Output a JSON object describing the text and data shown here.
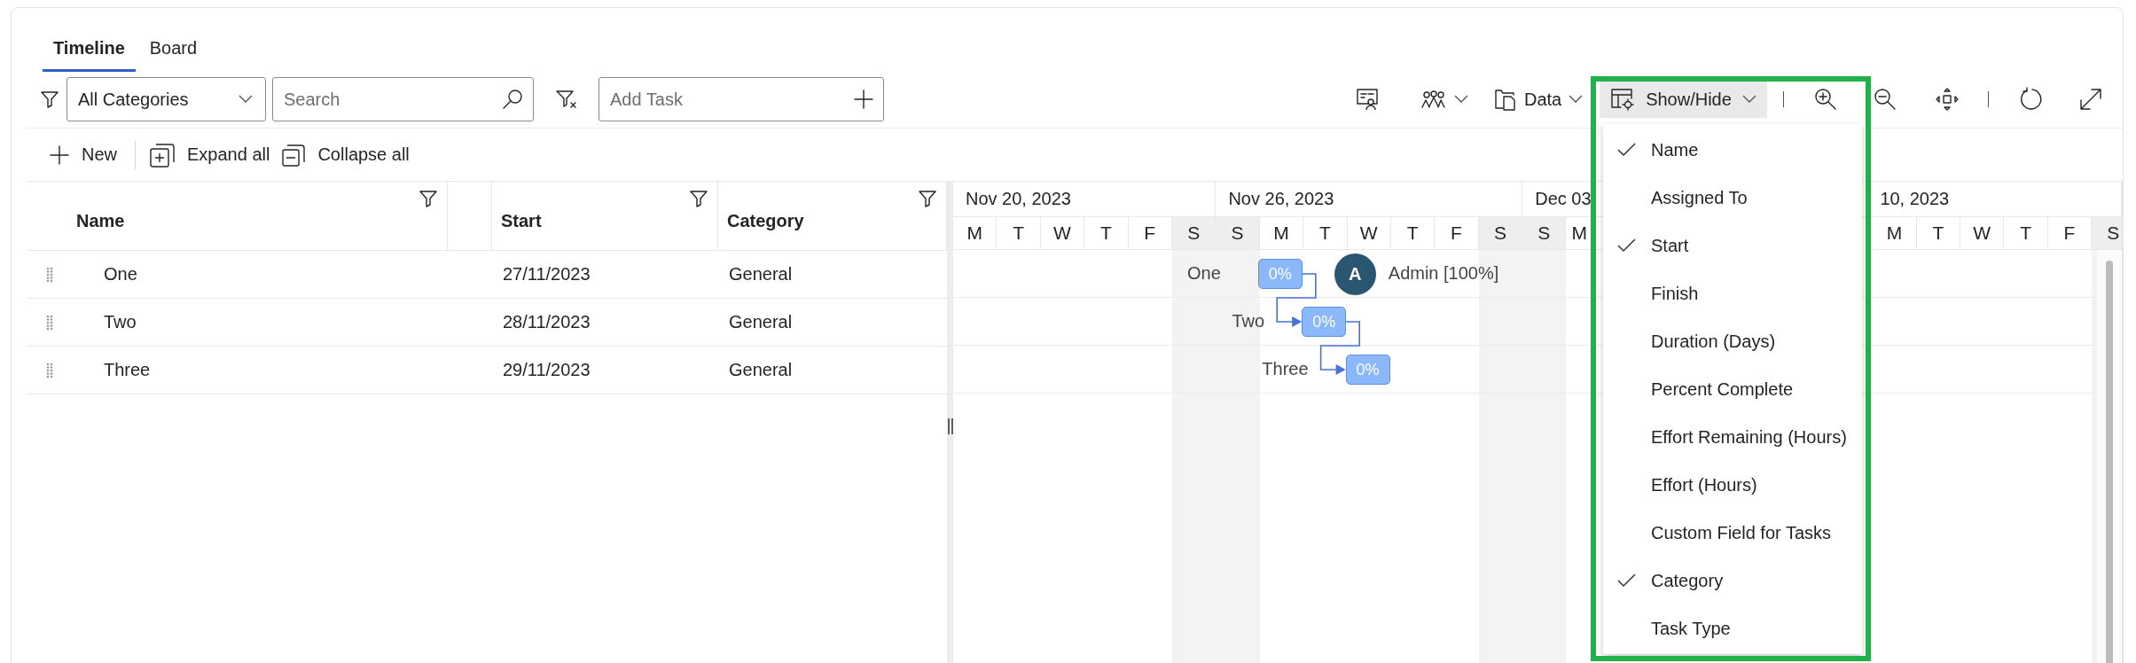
{
  "tabs": [
    {
      "label": "Timeline",
      "selected": true
    },
    {
      "label": "Board",
      "selected": false
    }
  ],
  "filters": {
    "category": "All Categories",
    "search": {
      "placeholder": "Search"
    },
    "add_task": {
      "placeholder": "Add Task"
    }
  },
  "toolbar": {
    "data": "Data",
    "show_hide": {
      "label": "Show/Hide",
      "expanded": true
    }
  },
  "commands": [
    {
      "kind": "new",
      "label": "New"
    },
    {
      "kind": "expand",
      "label": "Expand all"
    },
    {
      "kind": "collapse",
      "label": "Collapse all"
    }
  ],
  "grid": {
    "columns": [
      {
        "label": "Name",
        "filterable": true
      },
      {
        "label": "Start",
        "filterable": true
      },
      {
        "label": "Category",
        "filterable": true
      }
    ],
    "rows": [
      {
        "name": "One",
        "start": "27/11/2023",
        "category": "General"
      },
      {
        "name": "Two",
        "start": "28/11/2023",
        "category": "General"
      },
      {
        "name": "Three",
        "start": "29/11/2023",
        "category": "General"
      }
    ]
  },
  "timeline": {
    "weeks": [
      {
        "label": "Nov 20, 2023",
        "days": [
          {
            "label": "M",
            "weekend": false
          },
          {
            "label": "T",
            "weekend": false
          },
          {
            "label": "W",
            "weekend": false
          },
          {
            "label": "T",
            "weekend": false
          },
          {
            "label": "F",
            "weekend": false
          },
          {
            "label": "S",
            "weekend": true
          }
        ]
      },
      {
        "label": "Nov 26, 2023",
        "days": [
          {
            "label": "S",
            "weekend": true
          },
          {
            "label": "M",
            "weekend": false
          },
          {
            "label": "T",
            "weekend": false
          },
          {
            "label": "W",
            "weekend": false
          },
          {
            "label": "T",
            "weekend": false
          },
          {
            "label": "F",
            "weekend": false
          },
          {
            "label": "S",
            "weekend": true
          }
        ]
      },
      {
        "label": "Dec 03",
        "days": [
          {
            "label": "S",
            "weekend": true
          },
          {
            "label": "M",
            "weekend": false
          }
        ]
      },
      {
        "label": "10, 2023",
        "days": [
          {
            "label": "M",
            "weekend": false
          },
          {
            "label": "T",
            "weekend": false
          },
          {
            "label": "W",
            "weekend": false
          },
          {
            "label": "T",
            "weekend": false
          },
          {
            "label": "F",
            "weekend": false
          },
          {
            "label": "S",
            "weekend": true
          }
        ]
      }
    ],
    "tasks": [
      {
        "label": "One",
        "progress": "0%",
        "assignee": {
          "initial": "A",
          "name": "Admin [100%]"
        }
      },
      {
        "label": "Two",
        "progress": "0%",
        "linked_from_previous": true
      },
      {
        "label": "Three",
        "progress": "0%",
        "linked_from_previous": true
      }
    ]
  },
  "show_hide_menu": [
    {
      "label": "Name",
      "checked": true
    },
    {
      "label": "Assigned To",
      "checked": false
    },
    {
      "label": "Start",
      "checked": true
    },
    {
      "label": "Finish",
      "checked": false
    },
    {
      "label": "Duration (Days)",
      "checked": false
    },
    {
      "label": "Percent Complete",
      "checked": false
    },
    {
      "label": "Effort Remaining (Hours)",
      "checked": false
    },
    {
      "label": "Effort (Hours)",
      "checked": false
    },
    {
      "label": "Custom Field for Tasks",
      "checked": false
    },
    {
      "label": "Category",
      "checked": true
    },
    {
      "label": "Task Type",
      "checked": false
    }
  ]
}
